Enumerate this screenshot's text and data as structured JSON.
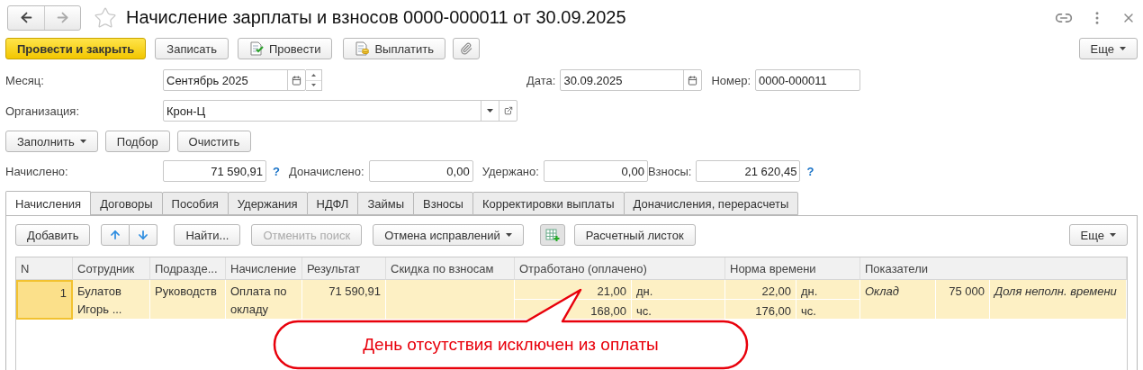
{
  "window": {
    "title": "Начисление зарплаты и взносов 0000-000011 от 30.09.2025"
  },
  "main_toolbar": [
    {
      "label": "Провести и закрыть",
      "kind": "primary"
    },
    {
      "label": "Записать",
      "kind": "plain"
    },
    {
      "label": "Провести",
      "kind": "document"
    },
    {
      "label": "Выплатить",
      "kind": "payment"
    },
    {
      "kind": "attach"
    }
  ],
  "more_button": "Еще",
  "month": {
    "label": "Месяц:",
    "value": "Сентябрь 2025"
  },
  "date": {
    "label": "Дата:",
    "value": "30.09.2025"
  },
  "number": {
    "label": "Номер:",
    "value": "0000-000011"
  },
  "organization": {
    "label": "Организация:",
    "value": "Крон-Ц"
  },
  "fill_buttons": [
    {
      "label": "Заполнить",
      "menu": true
    },
    {
      "label": "Подбор",
      "menu": false
    },
    {
      "label": "Очистить",
      "menu": false
    }
  ],
  "totals": [
    {
      "label": "Начислено:",
      "value": "71 590,91",
      "hint": "?"
    },
    {
      "label": "Доначислено:",
      "value": "0,00"
    },
    {
      "label": "Удержано:",
      "value": "0,00"
    },
    {
      "label": "Взносы:",
      "value": "21 620,45",
      "hint": "?"
    }
  ],
  "tabs": [
    {
      "label": "Начисления",
      "selected": true
    },
    {
      "label": "Договоры",
      "selected": false
    },
    {
      "label": "Пособия",
      "selected": false
    },
    {
      "label": "Удержания",
      "selected": false
    },
    {
      "label": "НДФЛ",
      "selected": false
    },
    {
      "label": "Займы",
      "selected": false
    },
    {
      "label": "Взносы",
      "selected": false
    },
    {
      "label": "Корректировки выплаты",
      "selected": false
    },
    {
      "label": "Доначисления, перерасчеты",
      "selected": false
    }
  ],
  "table_toolbar": [
    {
      "label": "Добавить",
      "kind": "plain",
      "disabled": false
    },
    {
      "kind": "up",
      "disabled": false
    },
    {
      "kind": "down",
      "disabled": false
    },
    {
      "label": "Найти...",
      "kind": "plain",
      "disabled": false
    },
    {
      "label": "Отменить поиск",
      "kind": "plain",
      "disabled": true
    },
    {
      "label": "Отмена исправлений",
      "kind": "menu",
      "disabled": false
    },
    {
      "kind": "settings",
      "disabled": false,
      "pressed": true
    },
    {
      "label": "Расчетный листок",
      "kind": "plain",
      "disabled": false
    }
  ],
  "table_more_button": "Еще",
  "table": {
    "columns": [
      "N",
      "Сотрудник",
      "Подразде...",
      "Начисление",
      "Результат",
      "Скидка по взносам",
      "Отработано (оплачено)",
      "Норма времени",
      "Показатели"
    ],
    "rows": [
      {
        "n": "1",
        "employee": "Булатов Игорь ...",
        "department": "Руководств",
        "accrual": "Оплата по окладу",
        "result": "71 590,91",
        "selected": true,
        "worked": [
          {
            "value": "21,00",
            "unit": "дн."
          },
          {
            "value": "168,00",
            "unit": "чс."
          }
        ],
        "norm": [
          {
            "value": "22,00",
            "unit": "дн."
          },
          {
            "value": "176,00",
            "unit": "чс."
          }
        ],
        "indicators": [
          {
            "name": "Оклад",
            "value": "75 000"
          },
          {
            "name": "Доля неполн. времени"
          }
        ]
      }
    ]
  },
  "callout": {
    "text": "День отсутствия исключен из оплаты"
  }
}
